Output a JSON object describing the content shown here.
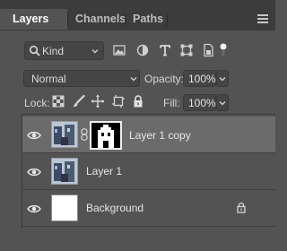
{
  "tabs": [
    {
      "label": "Layers",
      "active": true
    },
    {
      "label": "Channels",
      "active": false
    },
    {
      "label": "Paths",
      "active": false
    }
  ],
  "filter": {
    "kind_label": "Kind"
  },
  "blend": {
    "mode": "Normal",
    "opacity_label": "Opacity:",
    "opacity_value": "100%"
  },
  "lock": {
    "label": "Lock:",
    "fill_label": "Fill:",
    "fill_value": "100%"
  },
  "layers": [
    {
      "name": "Layer 1 copy",
      "selected": true,
      "visible": true,
      "has_mask": true,
      "locked": false
    },
    {
      "name": "Layer 1",
      "selected": false,
      "visible": true,
      "has_mask": false,
      "locked": false
    },
    {
      "name": "Background",
      "selected": false,
      "visible": true,
      "has_mask": false,
      "locked": true
    }
  ],
  "colors": {
    "panel": "#535353",
    "tabbar": "#3c3c3c",
    "selected_row": "#6b6b6b",
    "text": "#d6d6d6"
  }
}
